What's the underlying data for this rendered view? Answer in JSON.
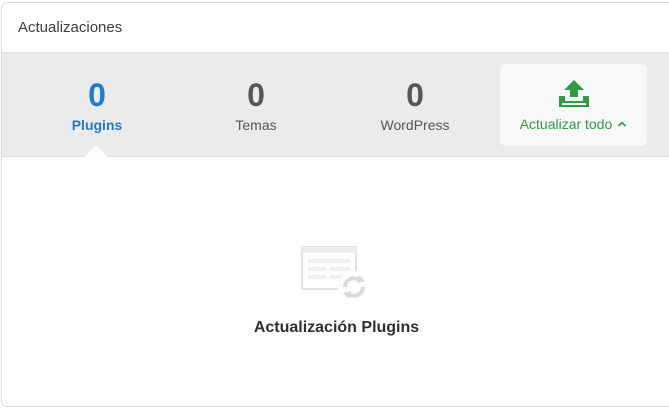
{
  "card": {
    "title": "Actualizaciones"
  },
  "stats": {
    "plugins": {
      "count": "0",
      "label": "Plugins"
    },
    "temas": {
      "count": "0",
      "label": "Temas"
    },
    "wordpress": {
      "count": "0",
      "label": "WordPress"
    }
  },
  "update_all": {
    "label": "Actualizar todo",
    "icon": "upload-tray-icon",
    "caret": "chevron-up-icon"
  },
  "empty_state": {
    "icon": "plugin-refresh-icon",
    "title": "Actualización Plugins"
  },
  "colors": {
    "accent_blue": "#1f7ac9",
    "accent_green": "#2e9b45",
    "bar_background": "#ebebeb"
  }
}
